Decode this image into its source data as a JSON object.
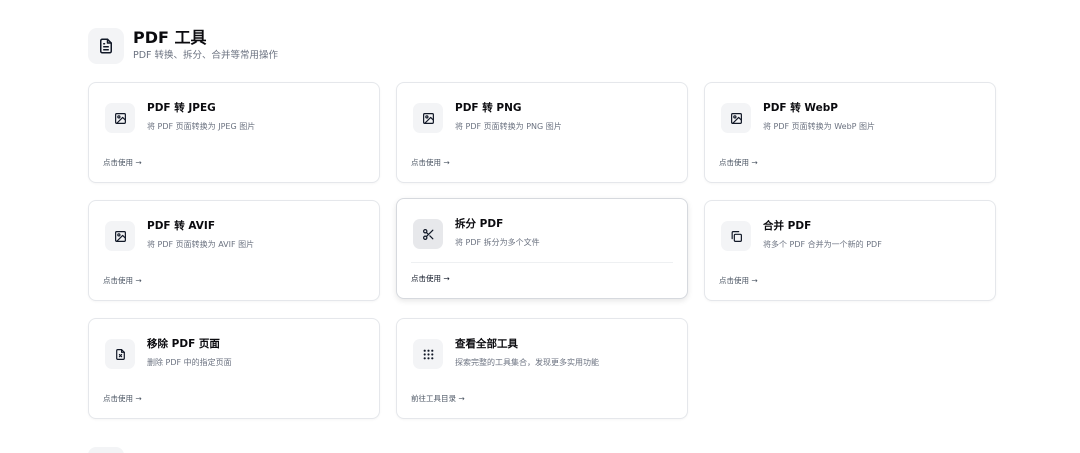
{
  "section": {
    "title": "PDF 工具",
    "subtitle": "PDF 转换、拆分、合并等常用操作",
    "icon": "document-icon"
  },
  "cards": [
    {
      "title": "PDF 转 JPEG",
      "desc": "将 PDF 页面转换为 JPEG 图片",
      "action": "点击使用 →",
      "icon": "image-icon"
    },
    {
      "title": "PDF 转 PNG",
      "desc": "将 PDF 页面转换为 PNG 图片",
      "action": "点击使用 →",
      "icon": "image-icon"
    },
    {
      "title": "PDF 转 WebP",
      "desc": "将 PDF 页面转换为 WebP 图片",
      "action": "点击使用 →",
      "icon": "image-icon"
    },
    {
      "title": "PDF 转 AVIF",
      "desc": "将 PDF 页面转换为 AVIF 图片",
      "action": "点击使用 →",
      "icon": "image-icon"
    },
    {
      "title": "拆分 PDF",
      "desc": "将 PDF 拆分为多个文件",
      "action": "点击使用 →",
      "icon": "scissors-icon"
    },
    {
      "title": "合并 PDF",
      "desc": "将多个 PDF 合并为一个新的 PDF",
      "action": "点击使用 →",
      "icon": "copy-icon"
    },
    {
      "title": "移除 PDF 页面",
      "desc": "删除 PDF 中的指定页面",
      "action": "点击使用 →",
      "icon": "file-remove-icon"
    },
    {
      "title": "查看全部工具",
      "desc": "探索完整的工具集合，发现更多实用功能",
      "action": "前往工具目录 →",
      "icon": "grid-dots-icon"
    }
  ]
}
